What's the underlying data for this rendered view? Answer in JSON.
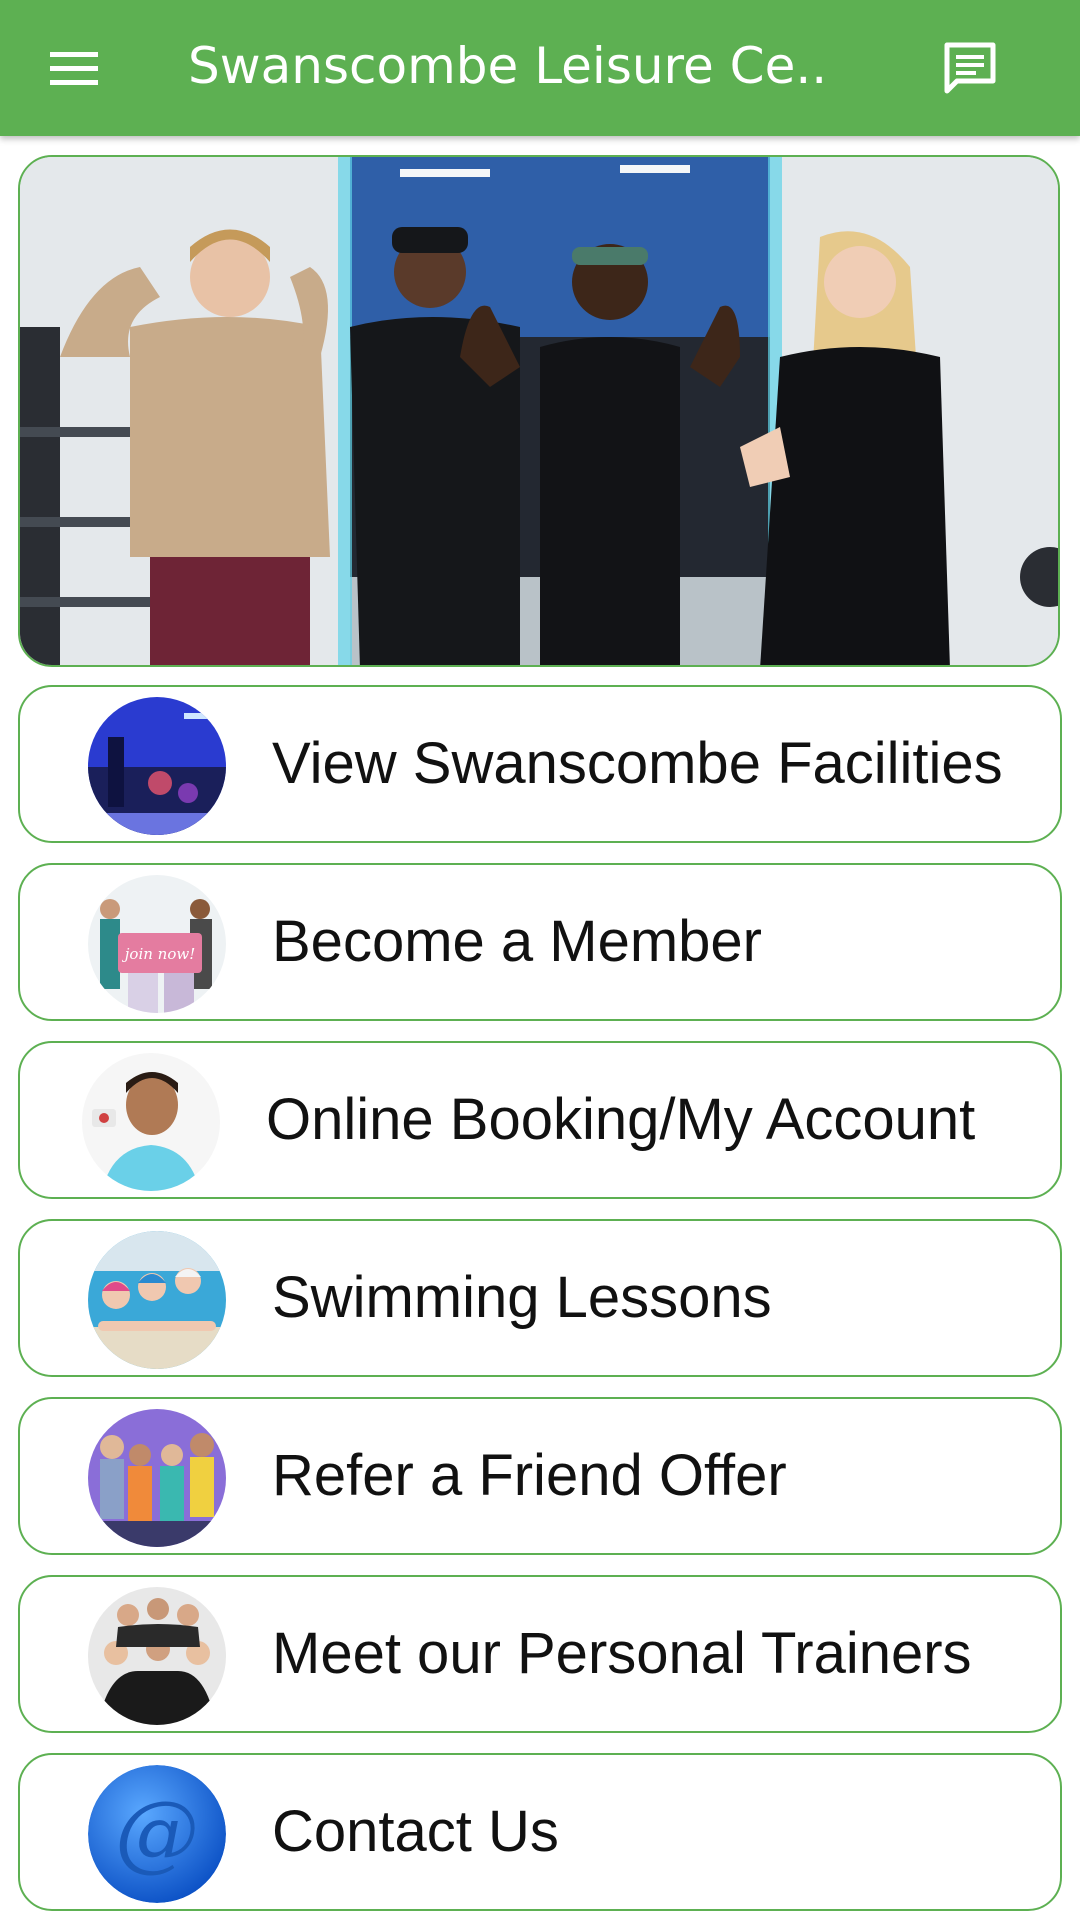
{
  "header": {
    "title": "Swanscombe Leisure Ce...",
    "menu_icon": "hamburger-menu-icon",
    "message_icon": "message-icon"
  },
  "hero": {
    "image": "group-of-gym-members-photo"
  },
  "menu": {
    "items": [
      {
        "label": "View Swanscombe Facilities",
        "image": "gym-facilities-thumbnail"
      },
      {
        "label": "Become a Member",
        "image": "join-now-thumbnail"
      },
      {
        "label": "Online Booking/My Account",
        "image": "smiling-man-thumbnail"
      },
      {
        "label": "Swimming Lessons",
        "image": "children-swimming-thumbnail"
      },
      {
        "label": "Refer a Friend Offer",
        "image": "group-of-friends-thumbnail"
      },
      {
        "label": "Meet our Personal Trainers",
        "image": "personal-trainers-thumbnail"
      },
      {
        "label": "Contact Us",
        "image": "at-sign-icon"
      }
    ]
  },
  "colors": {
    "brand_green": "#5db052",
    "text": "#111111"
  }
}
